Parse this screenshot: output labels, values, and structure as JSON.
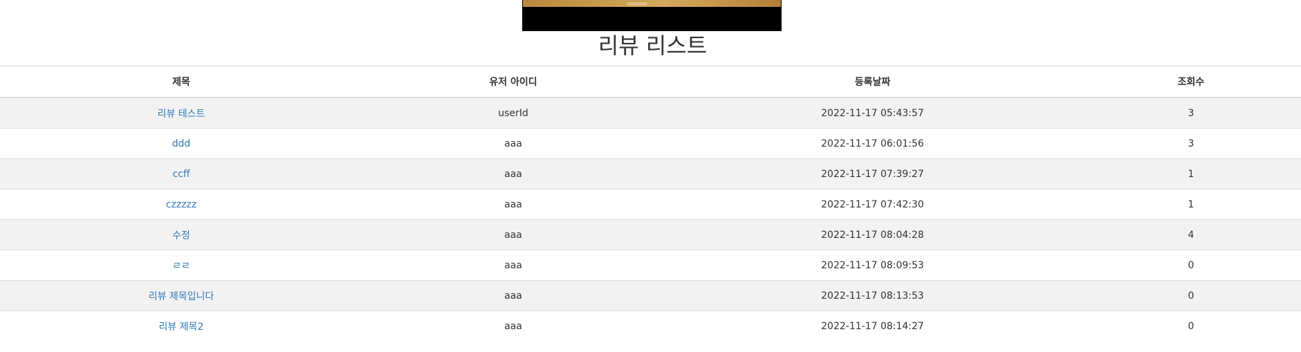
{
  "page": {
    "title": "리뷰 리스트"
  },
  "table": {
    "headers": {
      "title": "제목",
      "user_id": "유저 아이디",
      "date": "등록날짜",
      "views": "조회수"
    },
    "rows": [
      {
        "title": "리뷰 테스트",
        "user_id": "userId",
        "date": "2022-11-17 05:43:57",
        "views": "3"
      },
      {
        "title": "ddd",
        "user_id": "aaa",
        "date": "2022-11-17 06:01:56",
        "views": "3"
      },
      {
        "title": "ccff",
        "user_id": "aaa",
        "date": "2022-11-17 07:39:27",
        "views": "1"
      },
      {
        "title": "czzzzz",
        "user_id": "aaa",
        "date": "2022-11-17 07:42:30",
        "views": "1"
      },
      {
        "title": "수정",
        "user_id": "aaa",
        "date": "2022-11-17 08:04:28",
        "views": "4"
      },
      {
        "title": "ㄹㄹ",
        "user_id": "aaa",
        "date": "2022-11-17 08:09:53",
        "views": "0"
      },
      {
        "title": "리뷰 제목입니다",
        "user_id": "aaa",
        "date": "2022-11-17 08:13:53",
        "views": "0"
      },
      {
        "title": "리뷰 제목2",
        "user_id": "aaa",
        "date": "2022-11-17 08:14:27",
        "views": "0"
      }
    ]
  },
  "colors": {
    "link": "#337ab7",
    "stripe": "#f2f2f2",
    "border": "#dddddd"
  }
}
